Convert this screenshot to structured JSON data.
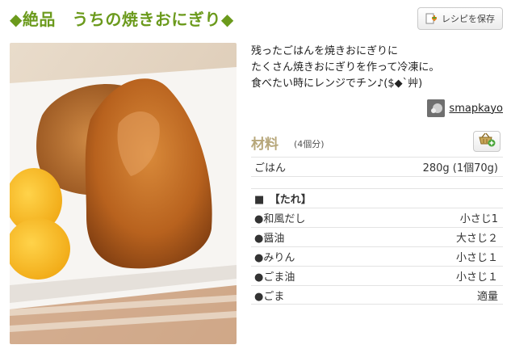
{
  "title": "◆絶品　うちの焼きおにぎり◆",
  "save_button": {
    "label": "レシピを保存",
    "icon": "bookmark-download-icon"
  },
  "description": [
    "残ったごはんを焼きおにぎりに",
    "たくさん焼きおにぎりを作って冷凍に。",
    "食べたい時にレンジでチン♪($◆`艸)"
  ],
  "author": {
    "name": "smapkayo"
  },
  "ingredients": {
    "title": "材料",
    "servings": "(4個分)",
    "main": [
      {
        "name": "ごはん",
        "amount": "280g (1個70g)"
      }
    ],
    "section_title": "■　【たれ】",
    "sauce": [
      {
        "name": "●和風だし",
        "amount": "小さじ1"
      },
      {
        "name": "●醤油",
        "amount": "大さじ２"
      },
      {
        "name": "●みりん",
        "amount": "小さじ１"
      },
      {
        "name": "●ごま油",
        "amount": "小さじ１"
      },
      {
        "name": "●ごま",
        "amount": "適量"
      }
    ]
  },
  "colors": {
    "title": "#6b9a1c",
    "ingredients_title": "#b7a77a"
  }
}
